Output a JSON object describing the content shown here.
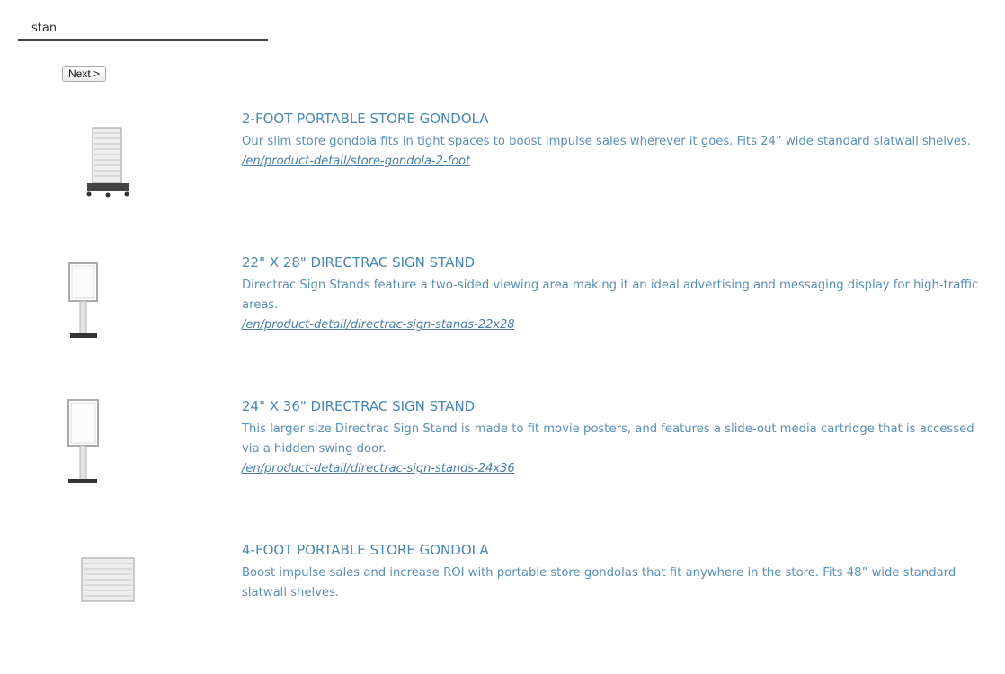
{
  "search": {
    "value": "stan"
  },
  "pager": {
    "next_label": "Next >"
  },
  "results": [
    {
      "title": "2-FOOT PORTABLE STORE GONDOLA",
      "description": "Our slim store gondola fits in tight spaces to boost impulse sales wherever it goes. Fits 24” wide standard slatwall shelves.",
      "url": "/en/product-detail/store-gondola-2-foot",
      "thumbnail_icon": "gondola-icon"
    },
    {
      "title": "22\" X 28\" DIRECTRAC SIGN STAND",
      "description": "Directrac Sign Stands feature a two-sided viewing area making it an ideal advertising and messaging display for high-traffic areas.",
      "url": "/en/product-detail/directrac-sign-stands-22x28",
      "thumbnail_icon": "sign-stand-icon"
    },
    {
      "title": "24\" X 36\" DIRECTRAC SIGN STAND",
      "description": "This larger size Directrac Sign Stand is made to fit movie posters, and features a slide-out media cartridge that is accessed via a hidden swing door.",
      "url": "/en/product-detail/directrac-sign-stands-24x36",
      "thumbnail_icon": "sign-stand-icon"
    },
    {
      "title": "4-FOOT PORTABLE STORE GONDOLA",
      "description": "Boost impulse sales and increase ROI with portable store gondolas that fit anywhere in the store. Fits 48” wide standard slatwall shelves.",
      "url": "",
      "thumbnail_icon": "gondola-icon"
    }
  ],
  "colors": {
    "accent": "#4a87b2",
    "text": "#5b8fb5",
    "underline": "#444444"
  }
}
